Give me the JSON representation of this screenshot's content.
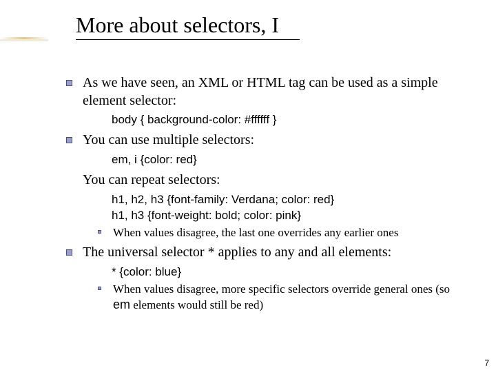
{
  "title": "More about selectors, I",
  "bullets": {
    "b1": "As we have seen, an XML or HTML tag can be used as a simple element selector:",
    "code1": "body { background-color: #ffffff }",
    "b2": "You can use multiple selectors:",
    "code2": "em, i {color: red}",
    "b3": "You can repeat selectors:",
    "code3a": "h1, h2, h3 {font-family: Verdana; color: red}",
    "code3b": "h1, h3 {font-weight: bold; color: pink}",
    "sub1": "When values disagree, the last one overrides any earlier ones",
    "b4": "The universal selector * applies to any and all elements:",
    "code4": "* {color: blue}",
    "sub2_a": "When values disagree, more specific selectors override general ones (so ",
    "sub2_em": "em",
    "sub2_b": " elements would still be red)"
  },
  "pagenum": "7"
}
